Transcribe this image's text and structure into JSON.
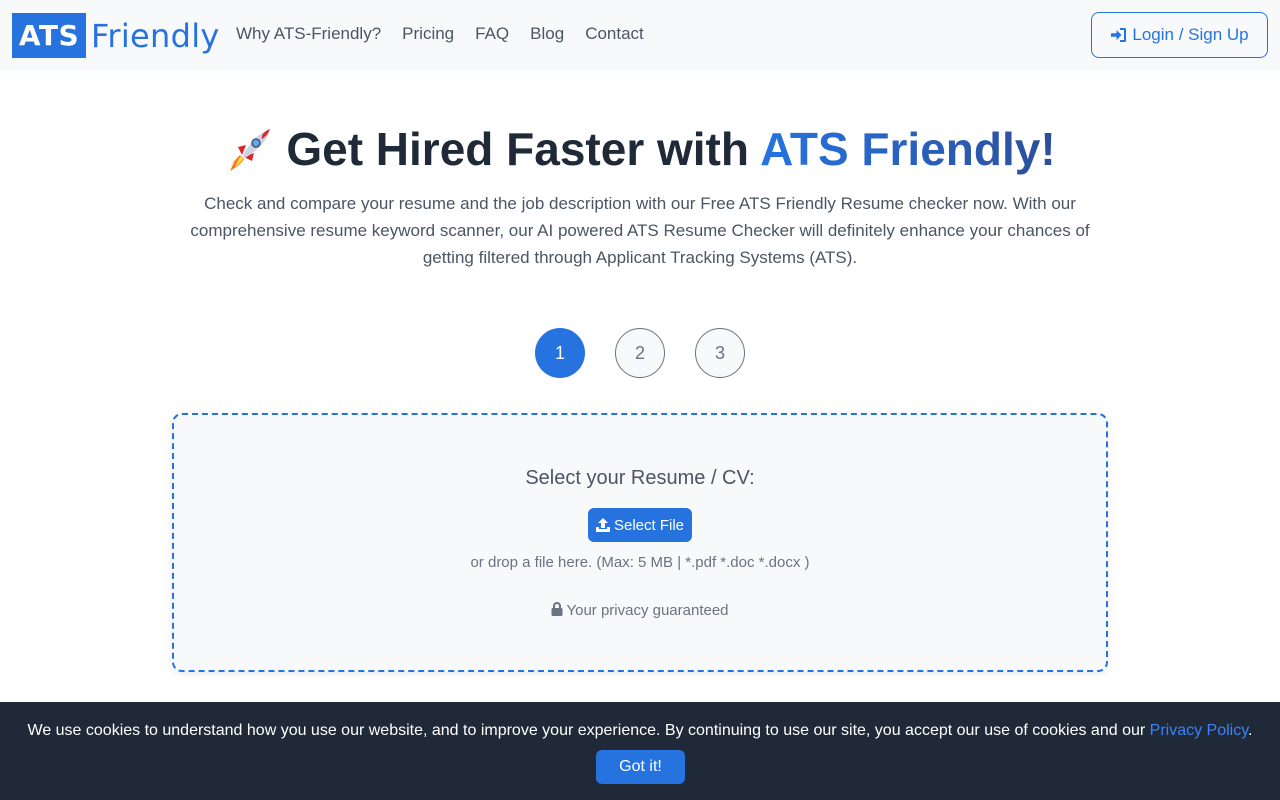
{
  "header": {
    "logo_box": "ATS",
    "logo_text": "Friendly",
    "nav": [
      "Why ATS-Friendly?",
      "Pricing",
      "FAQ",
      "Blog",
      "Contact"
    ],
    "login_label": "Login / Sign Up"
  },
  "hero": {
    "title_main": "Get Hired Faster with ",
    "title_accent": "ATS Friendly!",
    "description": "Check and compare your resume and the job description with our Free ATS Friendly Resume checker now. With our comprehensive resume keyword scanner, our AI powered ATS Resume Checker will definitely enhance your chances of getting filtered through Applicant Tracking Systems (ATS)."
  },
  "steps": [
    "1",
    "2",
    "3"
  ],
  "dropzone": {
    "title": "Select your Resume / CV:",
    "button_label": "Select File",
    "hint": "or drop a file here. (Max: 5 MB | *.pdf *.doc *.docx )",
    "privacy": "Your privacy guaranteed"
  },
  "cookie": {
    "text": "We use cookies to understand how you use our website, and to improve your experience. By continuing to use our site, you accept our use of cookies and our ",
    "link": "Privacy Policy",
    "end": ".",
    "button_label": "Got it!"
  },
  "colors": {
    "primary": "#2673e0",
    "dark": "#1f2937",
    "muted": "#6b7280",
    "light_bg": "#f8f9fb"
  }
}
